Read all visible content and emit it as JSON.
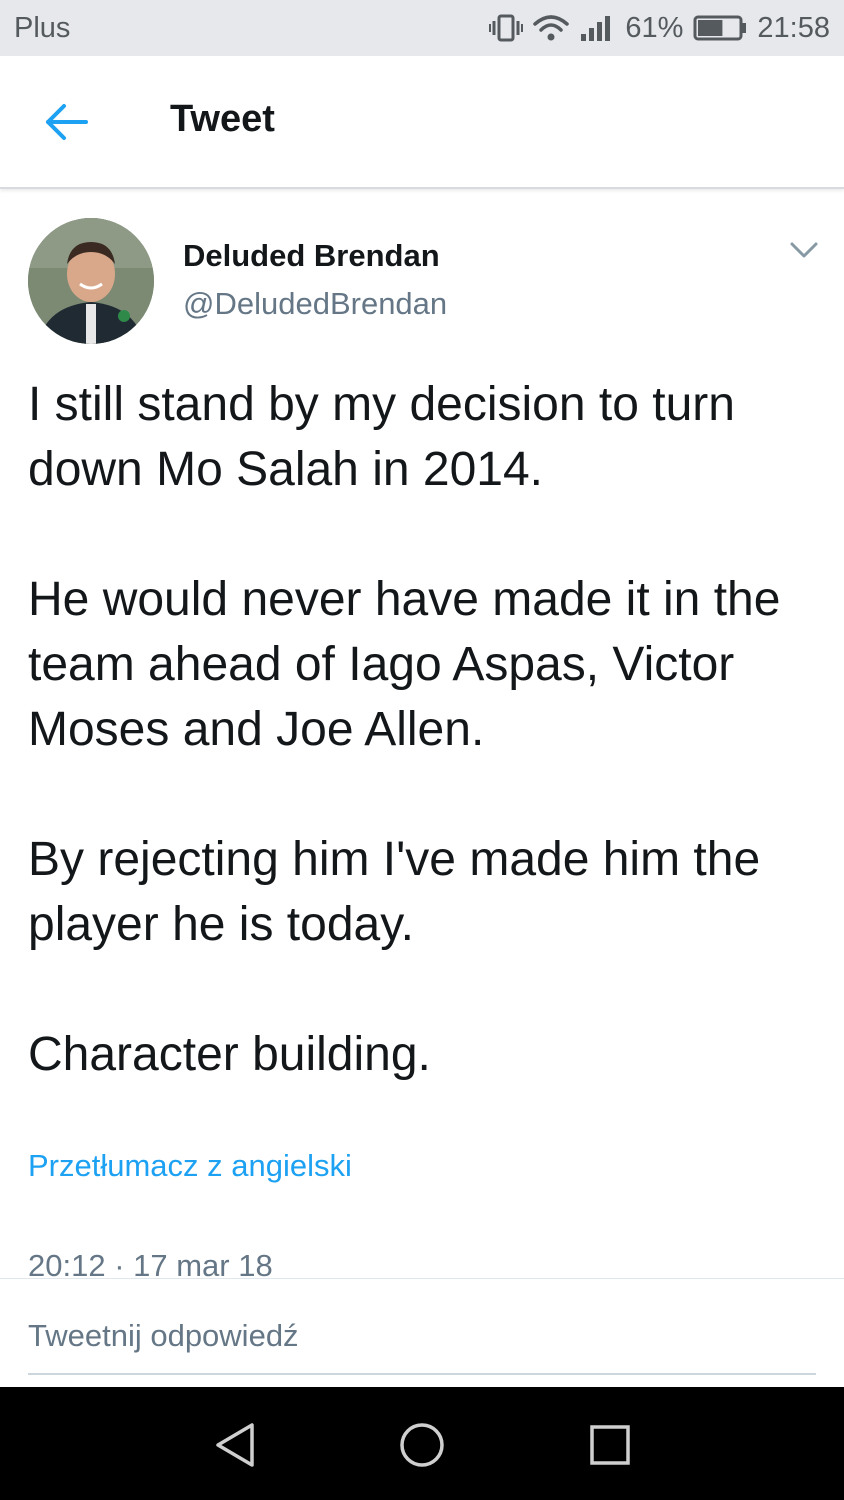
{
  "status_bar": {
    "carrier": "Plus",
    "battery_percent": "61%",
    "battery_level": 0.61,
    "time": "21:58",
    "icons": [
      "vibrate-icon",
      "wifi-icon",
      "signal-icon",
      "battery-icon"
    ]
  },
  "app_bar": {
    "title": "Tweet",
    "back_icon": "arrow-left-icon"
  },
  "tweet": {
    "author_name": "Deluded Brendan",
    "author_handle": "@DeludedBrendan",
    "menu_icon": "chevron-down-icon",
    "paragraphs": [
      "I still stand by my decision to turn down Mo Salah in 2014.",
      "He would never have made it in the team ahead of Iago Aspas, Victor Moses and Joe Allen.",
      "By rejecting him I've made him the player he is today.",
      "Character building."
    ],
    "translate_link": "Przetłumacz z angielski",
    "timestamp": "20:12 · 17 mar 18"
  },
  "reply": {
    "placeholder": "Tweetnij odpowiedź"
  },
  "nav_bar": {
    "icons": [
      "nav-back-icon",
      "nav-home-icon",
      "nav-recents-icon"
    ]
  },
  "colors": {
    "accent": "#1da1f2",
    "text_primary": "#14171a",
    "text_secondary": "#657786",
    "status_bar_bg": "#e6e8eb",
    "nav_bar_bg": "#000000"
  }
}
